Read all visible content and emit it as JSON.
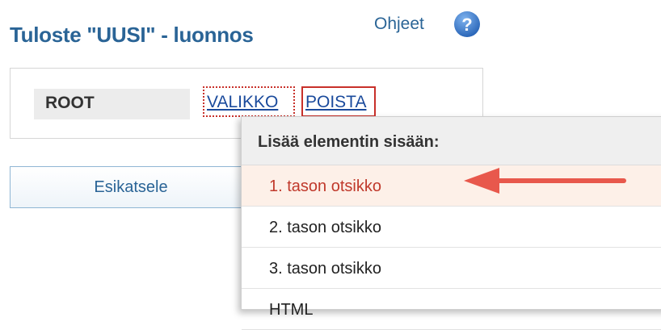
{
  "page": {
    "title": "Tuloste \"UUSI\" - luonnos",
    "help_label": "Ohjeet"
  },
  "root": {
    "label": "ROOT",
    "menu_link": "VALIKKO",
    "delete_link": "POISTA"
  },
  "preview_button": "Esikatsele",
  "menu": {
    "header": "Lisää elementin sisään:",
    "items": [
      {
        "label": "1. tason otsikko",
        "highlighted": true
      },
      {
        "label": "2. tason otsikko"
      },
      {
        "label": "3. tason otsikko"
      },
      {
        "label": "HTML"
      }
    ]
  },
  "colors": {
    "title_blue": "#2a6496",
    "link_blue": "#1a4a9c",
    "highlight_red": "#c0392b",
    "arrow_red": "#e8584c",
    "help_icon_blue": "#3a7fd0"
  },
  "icons": [
    "question-mark-icon",
    "red-arrow-pointer"
  ]
}
